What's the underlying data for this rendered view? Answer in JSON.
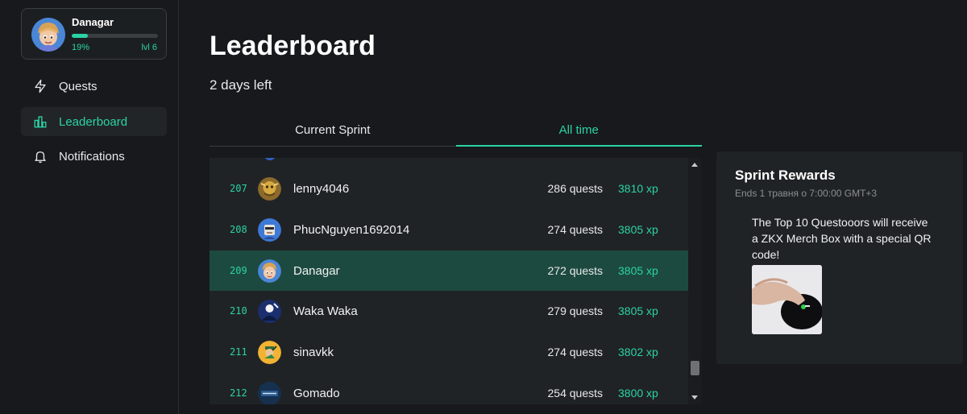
{
  "profile": {
    "name": "Danagar",
    "progress_label": "19%",
    "progress_value": 0.19,
    "level": "lvl 6"
  },
  "nav": [
    {
      "label": "Quests",
      "icon": "lightning-icon"
    },
    {
      "label": "Leaderboard",
      "icon": "bar-chart-icon"
    },
    {
      "label": "Notifications",
      "icon": "bell-icon"
    }
  ],
  "page": {
    "title": "Leaderboard",
    "days_left": "2 days left"
  },
  "tabs": [
    {
      "label": "Current Sprint"
    },
    {
      "label": "All time"
    }
  ],
  "rows": [
    {
      "rank": "207",
      "name": "lenny4046",
      "quests": "286 quests",
      "xp": "3810 xp"
    },
    {
      "rank": "208",
      "name": "PhucNguyen1692014",
      "quests": "274 quests",
      "xp": "3805 xp"
    },
    {
      "rank": "209",
      "name": "Danagar",
      "quests": "272 quests",
      "xp": "3805 xp"
    },
    {
      "rank": "210",
      "name": "Waka Waka",
      "quests": "279 quests",
      "xp": "3805 xp"
    },
    {
      "rank": "211",
      "name": "sinavkk",
      "quests": "274 quests",
      "xp": "3802 xp"
    },
    {
      "rank": "212",
      "name": "Gomado",
      "quests": "254 quests",
      "xp": "3800 xp"
    }
  ],
  "rewards": {
    "title": "Sprint Rewards",
    "ends": "Ends 1 травня о 7:00:00 GMT+3",
    "description": "The Top 10 Questooors will receive a ZKX Merch Box with a special QR code!"
  },
  "colors": {
    "accent": "#2ad3a5",
    "background": "#17191c",
    "panel": "#202326",
    "highlight_row": "#1d4a40"
  }
}
